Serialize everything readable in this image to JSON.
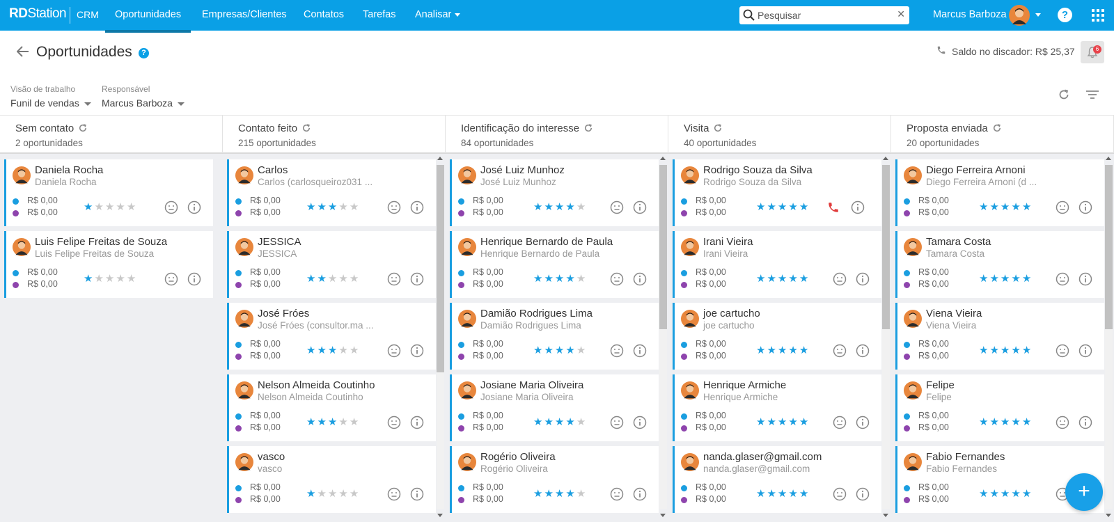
{
  "navbar": {
    "brand_bold": "RD",
    "brand_light": "Station",
    "product": "CRM",
    "items": [
      {
        "label": "Oportunidades",
        "active": true
      },
      {
        "label": "Empresas/Clientes",
        "active": false
      },
      {
        "label": "Contatos",
        "active": false
      },
      {
        "label": "Tarefas",
        "active": false
      },
      {
        "label": "Analisar",
        "active": false,
        "dropdown": true
      }
    ],
    "search_placeholder": "Pesquisar",
    "user_name": "Marcus Barboza",
    "help_icon": "question-circle-icon",
    "apps_icon": "apps-grid-icon",
    "color": "#0aa0e6"
  },
  "header": {
    "title": "Oportunidades",
    "saldo_label": "Saldo no discador: R$ 25,37",
    "notification_count": "6"
  },
  "filters": {
    "vision_label": "Visão de trabalho",
    "vision_value": "Funil de vendas",
    "owner_label": "Responsável",
    "owner_value": "Marcus Barboza"
  },
  "columns": [
    {
      "name": "Sem contato",
      "count": "2 oportunidades",
      "cards": [
        {
          "name": "Daniela Rocha",
          "sub": "Daniela Rocha",
          "v1": "R$ 0,00",
          "v2": "R$ 0,00",
          "stars": 1
        },
        {
          "name": "Luis Felipe Freitas de Souza",
          "sub": "Luis Felipe Freitas de Souza",
          "v1": "R$ 0,00",
          "v2": "R$ 0,00",
          "stars": 1
        }
      ]
    },
    {
      "name": "Contato feito",
      "count": "215 oportunidades",
      "cards": [
        {
          "name": "Carlos",
          "sub": "Carlos (carlosqueiroz031 ...",
          "v1": "R$ 0,00",
          "v2": "R$ 0,00",
          "stars": 3
        },
        {
          "name": "JESSICA",
          "sub": "JESSICA",
          "v1": "R$ 0,00",
          "v2": "R$ 0,00",
          "stars": 2
        },
        {
          "name": "José Fróes",
          "sub": "José Fróes (consultor.ma ...",
          "v1": "R$ 0,00",
          "v2": "R$ 0,00",
          "stars": 3
        },
        {
          "name": "Nelson Almeida Coutinho",
          "sub": "Nelson Almeida Coutinho",
          "v1": "R$ 0,00",
          "v2": "R$ 0,00",
          "stars": 3
        },
        {
          "name": "vasco",
          "sub": "vasco",
          "v1": "R$ 0,00",
          "v2": "R$ 0,00",
          "stars": 1
        }
      ]
    },
    {
      "name": "Identificação do interesse",
      "count": "84 oportunidades",
      "cards": [
        {
          "name": "José Luiz Munhoz",
          "sub": "José Luiz Munhoz",
          "v1": "R$ 0,00",
          "v2": "R$ 0,00",
          "stars": 4
        },
        {
          "name": "Henrique Bernardo de Paula",
          "sub": "Henrique Bernardo de Paula",
          "v1": "R$ 0,00",
          "v2": "R$ 0,00",
          "stars": 4
        },
        {
          "name": "Damião Rodrigues Lima",
          "sub": "Damião Rodrigues Lima",
          "v1": "R$ 0,00",
          "v2": "R$ 0,00",
          "stars": 4
        },
        {
          "name": "Josiane Maria Oliveira",
          "sub": "Josiane Maria Oliveira",
          "v1": "R$ 0,00",
          "v2": "R$ 0,00",
          "stars": 4
        },
        {
          "name": "Rogério Oliveira",
          "sub": "Rogério Oliveira",
          "v1": "R$ 0,00",
          "v2": "R$ 0,00",
          "stars": 4
        }
      ]
    },
    {
      "name": "Visita",
      "count": "40 oportunidades",
      "cards": [
        {
          "name": "Rodrigo Souza da Silva",
          "sub": "Rodrigo Souza da Silva",
          "v1": "R$ 0,00",
          "v2": "R$ 0,00",
          "stars": 5,
          "phone": true
        },
        {
          "name": "Irani Vieira",
          "sub": "Irani Vieira",
          "v1": "R$ 0,00",
          "v2": "R$ 0,00",
          "stars": 5
        },
        {
          "name": "joe cartucho",
          "sub": "joe cartucho",
          "v1": "R$ 0,00",
          "v2": "R$ 0,00",
          "stars": 5
        },
        {
          "name": "Henrique Armiche",
          "sub": "Henrique Armiche",
          "v1": "R$ 0,00",
          "v2": "R$ 0,00",
          "stars": 5
        },
        {
          "name": "nanda.glaser@gmail.com",
          "sub": "nanda.glaser@gmail.com",
          "v1": "R$ 0,00",
          "v2": "R$ 0,00",
          "stars": 5
        }
      ]
    },
    {
      "name": "Proposta enviada",
      "count": "20 oportunidades",
      "cards": [
        {
          "name": "Diego Ferreira Arnoni",
          "sub": "Diego Ferreira Arnoni (d ...",
          "v1": "R$ 0,00",
          "v2": "R$ 0,00",
          "stars": 5
        },
        {
          "name": "Tamara Costa",
          "sub": "Tamara Costa",
          "v1": "R$ 0,00",
          "v2": "R$ 0,00",
          "stars": 5
        },
        {
          "name": "Viena Vieira",
          "sub": "Viena Vieira",
          "v1": "R$ 0,00",
          "v2": "R$ 0,00",
          "stars": 5
        },
        {
          "name": "Felipe",
          "sub": "Felipe",
          "v1": "R$ 0,00",
          "v2": "R$ 0,00",
          "stars": 5
        },
        {
          "name": "Fabio Fernandes",
          "sub": "Fabio Fernandes",
          "v1": "R$ 0,00",
          "v2": "R$ 0,00",
          "stars": 5
        }
      ]
    }
  ],
  "fab_label": "+",
  "colors": {
    "accent": "#1a9ee0",
    "purple": "#8e44ad",
    "phone_red": "#e03b3b"
  }
}
